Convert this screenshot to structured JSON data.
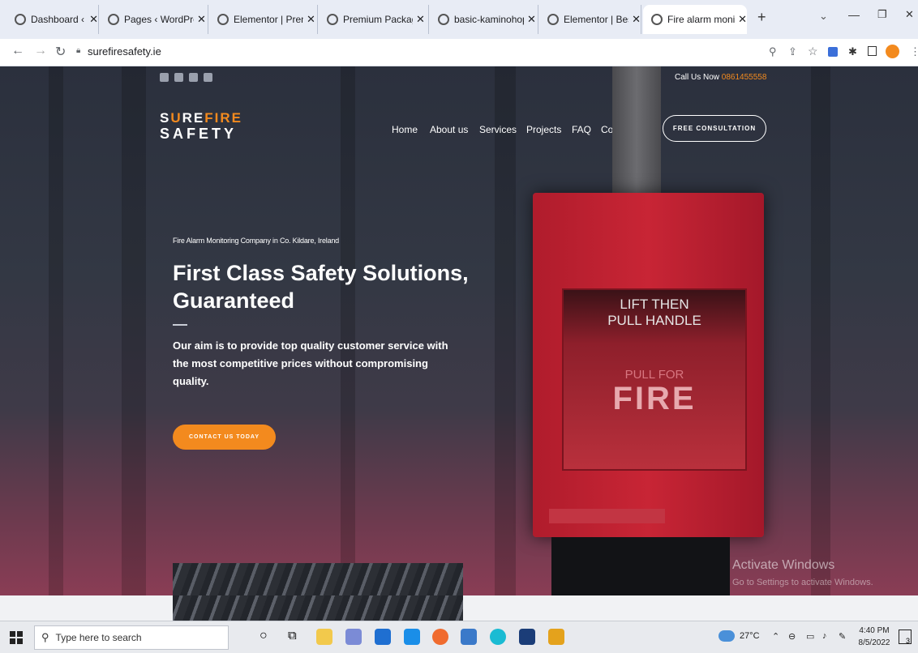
{
  "browser": {
    "tabs": [
      {
        "title": "Dashboard ‹ Wor"
      },
      {
        "title": "Pages ‹ WordPre"
      },
      {
        "title": "Elementor | Prem"
      },
      {
        "title": "Premium Packag"
      },
      {
        "title": "basic-kaminohop"
      },
      {
        "title": "Elementor | Besp"
      },
      {
        "title": "Fire alarm monit"
      }
    ],
    "url": "surefiresafety.ie",
    "new_tab": "+"
  },
  "site": {
    "logo_top_a": "S",
    "logo_top_o": "U",
    "logo_top_b": "RE",
    "logo_top_c": "FIRE",
    "logo_bottom": "SAFETY",
    "call_label": "Call Us Now",
    "call_number": "0861455558",
    "nav": [
      "Home",
      "About us",
      "Services",
      "Projects",
      "FAQ",
      "Contact us"
    ],
    "consult_button": "FREE CONSULTATION",
    "eyebrow": "Fire Alarm Monitoring Company in Co. Kildare, Ireland",
    "headline": "First Class Safety Solutions, Guaranteed",
    "body": "Our aim is to provide top quality customer service with the most competitive prices without compromising quality.",
    "cta": "CONTACT US TODAY",
    "alarm_line1": "LIFT THEN",
    "alarm_line2": "PULL HANDLE",
    "alarm_line3": "PULL FOR",
    "alarm_line4": "FIRE"
  },
  "watermark": {
    "title": "Activate Windows",
    "subtitle": "Go to Settings to activate Windows."
  },
  "taskbar": {
    "search_placeholder": "Type here to search",
    "temperature": "27°C",
    "time": "4:40 PM",
    "date": "8/5/2022",
    "notification_count": "3"
  },
  "colors": {
    "accent": "#f38a1e"
  }
}
